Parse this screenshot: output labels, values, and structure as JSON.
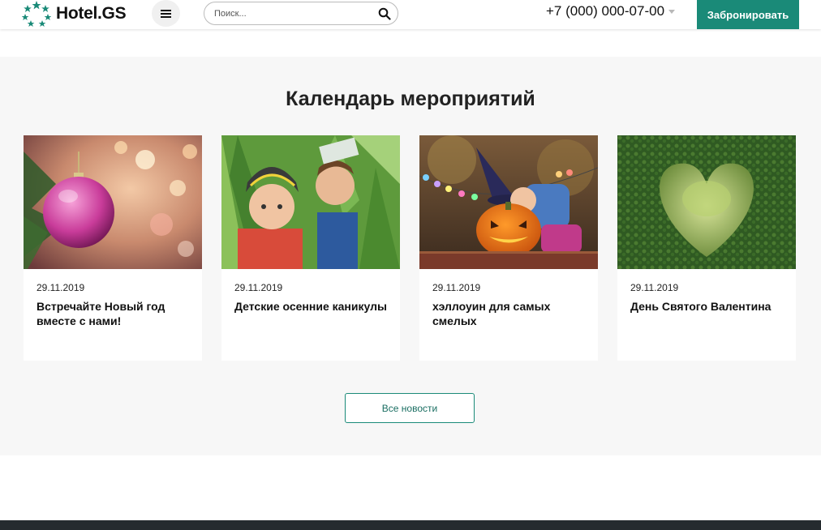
{
  "header": {
    "logo_text": "Hotel.GS",
    "search_placeholder": "Поиск...",
    "phone": "+7 (000) 000-07-00",
    "book_label": "Забронировать"
  },
  "colors": {
    "accent": "#1a8a78",
    "section_bg": "#f7f7f7",
    "footer": "#252b2f"
  },
  "events": {
    "title": "Календарь мероприятий",
    "cards": [
      {
        "date": "29.11.2019",
        "title": "Встречайте Новый год вместе с нами!",
        "image": "christmas-ornament"
      },
      {
        "date": "29.11.2019",
        "title": "Детские осенние каникулы",
        "image": "kids-in-corn"
      },
      {
        "date": "29.11.2019",
        "title": "хэллоуин для самых смелых",
        "image": "halloween-pumpkin"
      },
      {
        "date": "29.11.2019",
        "title": "День Святого Валентина",
        "image": "heart-hedge"
      }
    ],
    "all_news_label": "Все новости"
  }
}
